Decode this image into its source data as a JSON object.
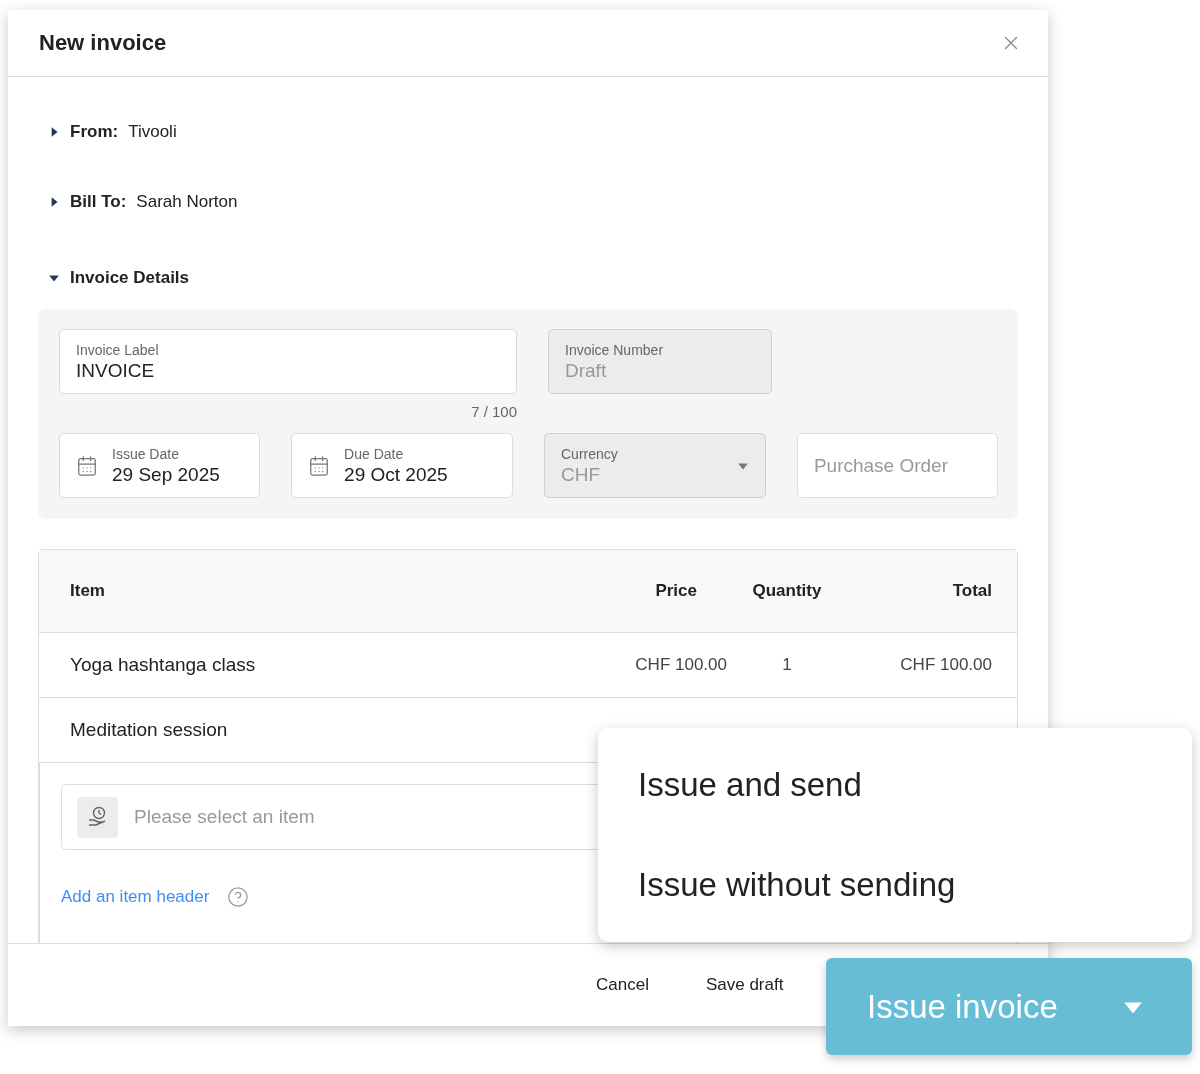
{
  "dialog": {
    "title": "New invoice"
  },
  "sections": [
    {
      "label": "From:",
      "value": "Tivooli",
      "expanded": false
    },
    {
      "label": "Bill To:",
      "value": "Sarah Norton",
      "expanded": false
    },
    {
      "label": "Invoice Details",
      "expanded": true,
      "field_rows": [
        [
          {
            "kind": "text",
            "label": "Invoice Label",
            "value": "INVOICE",
            "counter": "7 / 100",
            "disabled": false
          },
          {
            "kind": "text",
            "label": "Invoice Number",
            "value": "Draft",
            "disabled": true
          }
        ],
        [
          {
            "kind": "date",
            "label": "Issue Date",
            "value": "29 Sep 2025",
            "disabled": false
          },
          {
            "kind": "date",
            "label": "Due Date",
            "value": "29 Oct 2025",
            "disabled": false
          },
          {
            "kind": "select",
            "label": "Currency",
            "value": "CHF",
            "disabled": true
          },
          {
            "kind": "empty",
            "placeholder": "Purchase Order",
            "disabled": false
          }
        ]
      ]
    }
  ],
  "table": {
    "columns": [
      "Item",
      "Price",
      "Quantity",
      "Total"
    ],
    "rows": [
      [
        "Yoga hashtanga class",
        "CHF 100.00",
        "1",
        "CHF 100.00"
      ],
      [
        "Meditation session"
      ]
    ]
  },
  "item_picker": {
    "placeholder": "Please select an item"
  },
  "add_header_link": "Add an item header",
  "footer": {
    "buttons": [
      "Cancel",
      "Save draft"
    ],
    "primary": "Issue invoice"
  },
  "issue_menu": {
    "open": true,
    "items": [
      "Issue and send",
      "Issue without sending"
    ]
  }
}
